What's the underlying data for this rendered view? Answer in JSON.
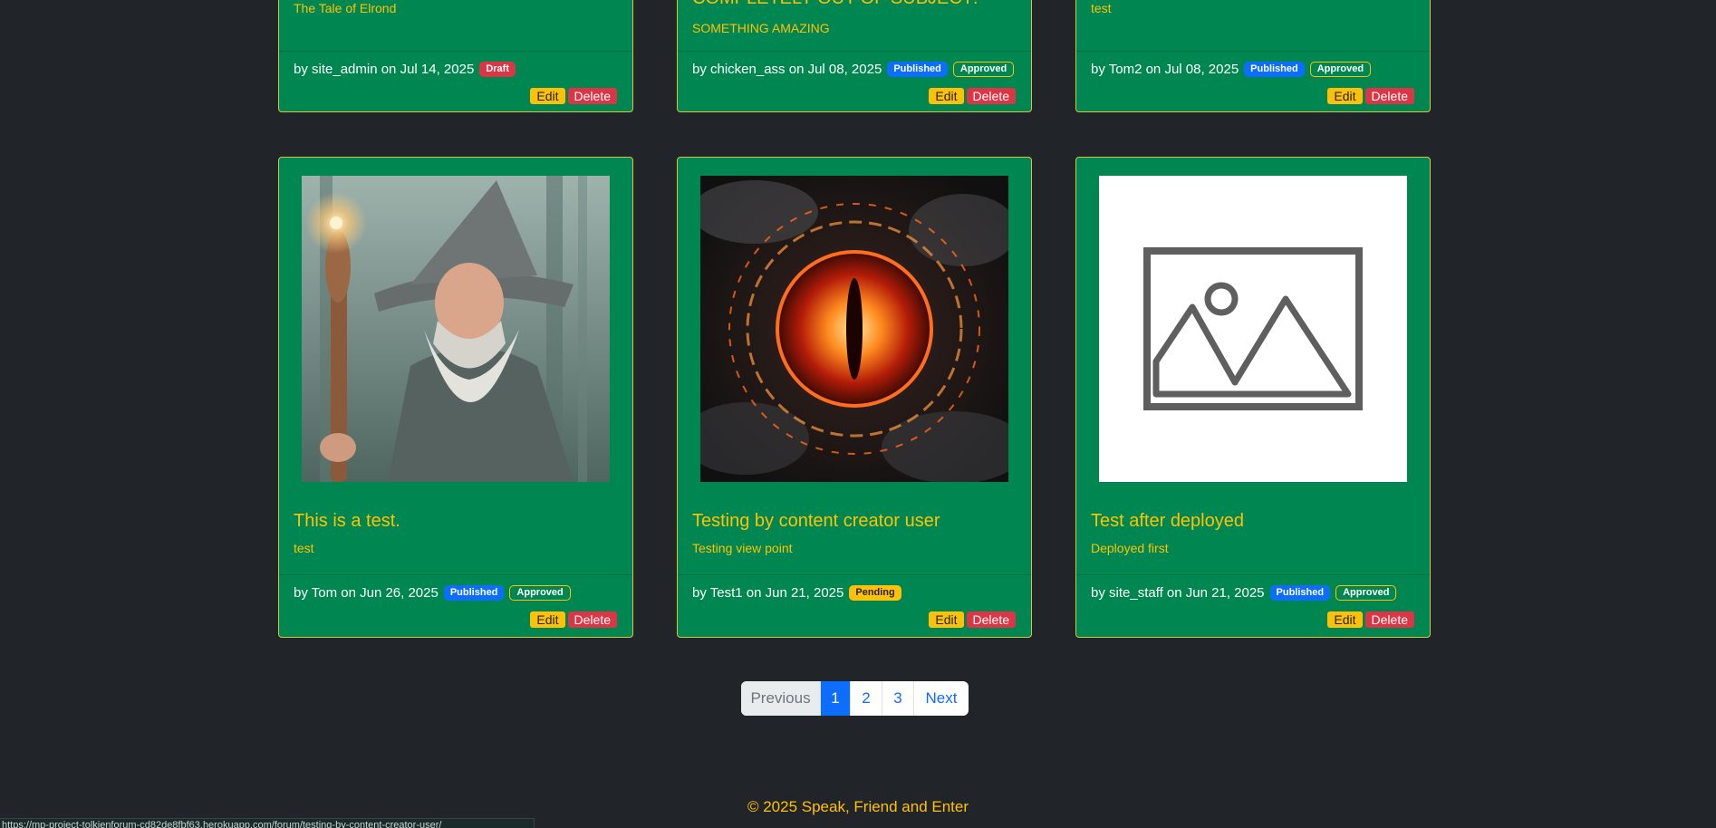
{
  "colors": {
    "page_bg": "#212529",
    "card_bg": "#008751",
    "accent": "#ffc107",
    "card_border": "#d7c43a"
  },
  "top_cards": [
    {
      "text": "The Tale of Elrond",
      "byline": "by site_admin on Jul 14, 2025",
      "badges": [
        "Draft"
      ],
      "edit": "Edit",
      "delete": "Delete"
    },
    {
      "title": "COMPLETELY OUT OF SUBJECT!",
      "text": "SOMETHING AMAZING",
      "byline": "by chicken_ass on Jul 08, 2025",
      "badges": [
        "Published",
        "Approved"
      ],
      "edit": "Edit",
      "delete": "Delete"
    },
    {
      "text": "test",
      "byline": "by Tom2 on Jul 08, 2025",
      "badges": [
        "Published",
        "Approved"
      ],
      "edit": "Edit",
      "delete": "Delete"
    }
  ],
  "cards": [
    {
      "image": "wizard-image",
      "title": "This is a test.",
      "text": "test",
      "byline": "by Tom on Jun 26, 2025",
      "badges": [
        "Published",
        "Approved"
      ],
      "edit": "Edit",
      "delete": "Delete"
    },
    {
      "image": "fiery-eye-image",
      "title": "Testing by content creator user",
      "text": "Testing view point",
      "byline": "by Test1 on Jun 21, 2025",
      "badges": [
        "Pending"
      ],
      "edit": "Edit",
      "delete": "Delete"
    },
    {
      "image": "image-placeholder-icon",
      "title": "Test after deployed",
      "text": "Deployed first",
      "byline": "by site_staff on Jun 21, 2025",
      "badges": [
        "Published",
        "Approved"
      ],
      "edit": "Edit",
      "delete": "Delete"
    }
  ],
  "pagination": {
    "previous": "Previous",
    "pages": [
      "1",
      "2",
      "3"
    ],
    "active": "1",
    "next": "Next"
  },
  "footer": {
    "copyright": "© 2025 Speak, Friend and Enter"
  },
  "status_bar": {
    "url": "https://mp-project-tolkienforum-cd82de8fbf63.herokuapp.com/forum/testing-by-content-creator-user/"
  }
}
